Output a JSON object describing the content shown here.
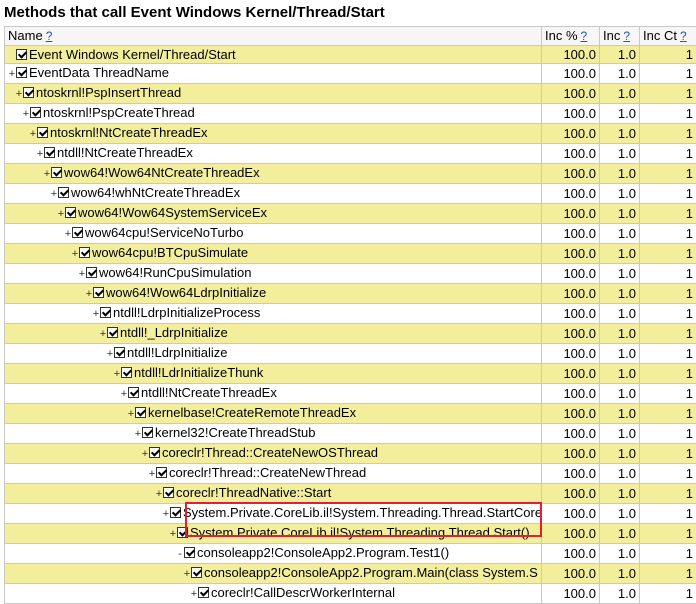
{
  "title": "Methods that call Event Windows Kernel/Thread/Start",
  "help_label": "?",
  "columns": {
    "name": "Name",
    "inc_pct": "Inc %",
    "inc": "Inc",
    "inc_ct": "Inc Ct"
  },
  "rows": [
    {
      "name": "Event Windows Kernel/Thread/Start",
      "indent": 0,
      "expander": "",
      "highlight": true,
      "inc_pct": "100.0",
      "inc": "1.0",
      "inc_ct": "1"
    },
    {
      "name": "EventData ThreadName",
      "indent": 0,
      "expander": "+",
      "highlight": false,
      "inc_pct": "100.0",
      "inc": "1.0",
      "inc_ct": "1"
    },
    {
      "name": "ntoskrnl!PspInsertThread",
      "indent": 1,
      "expander": "+",
      "highlight": true,
      "inc_pct": "100.0",
      "inc": "1.0",
      "inc_ct": "1"
    },
    {
      "name": "ntoskrnl!PspCreateThread",
      "indent": 2,
      "expander": "+",
      "highlight": false,
      "inc_pct": "100.0",
      "inc": "1.0",
      "inc_ct": "1"
    },
    {
      "name": "ntoskrnl!NtCreateThreadEx",
      "indent": 3,
      "expander": "+",
      "highlight": true,
      "inc_pct": "100.0",
      "inc": "1.0",
      "inc_ct": "1"
    },
    {
      "name": "ntdll!NtCreateThreadEx",
      "indent": 4,
      "expander": "+",
      "highlight": false,
      "inc_pct": "100.0",
      "inc": "1.0",
      "inc_ct": "1"
    },
    {
      "name": "wow64!Wow64NtCreateThreadEx",
      "indent": 5,
      "expander": "+",
      "highlight": true,
      "inc_pct": "100.0",
      "inc": "1.0",
      "inc_ct": "1"
    },
    {
      "name": "wow64!whNtCreateThreadEx",
      "indent": 6,
      "expander": "+",
      "highlight": false,
      "inc_pct": "100.0",
      "inc": "1.0",
      "inc_ct": "1"
    },
    {
      "name": "wow64!Wow64SystemServiceEx",
      "indent": 7,
      "expander": "+",
      "highlight": true,
      "inc_pct": "100.0",
      "inc": "1.0",
      "inc_ct": "1"
    },
    {
      "name": "wow64cpu!ServiceNoTurbo",
      "indent": 8,
      "expander": "+",
      "highlight": false,
      "inc_pct": "100.0",
      "inc": "1.0",
      "inc_ct": "1"
    },
    {
      "name": "wow64cpu!BTCpuSimulate",
      "indent": 9,
      "expander": "+",
      "highlight": true,
      "inc_pct": "100.0",
      "inc": "1.0",
      "inc_ct": "1"
    },
    {
      "name": "wow64!RunCpuSimulation",
      "indent": 10,
      "expander": "+",
      "highlight": false,
      "inc_pct": "100.0",
      "inc": "1.0",
      "inc_ct": "1"
    },
    {
      "name": "wow64!Wow64LdrpInitialize",
      "indent": 11,
      "expander": "+",
      "highlight": true,
      "inc_pct": "100.0",
      "inc": "1.0",
      "inc_ct": "1"
    },
    {
      "name": "ntdll!LdrpInitializeProcess",
      "indent": 12,
      "expander": "+",
      "highlight": false,
      "inc_pct": "100.0",
      "inc": "1.0",
      "inc_ct": "1"
    },
    {
      "name": "ntdll!_LdrpInitialize",
      "indent": 13,
      "expander": "+",
      "highlight": true,
      "inc_pct": "100.0",
      "inc": "1.0",
      "inc_ct": "1"
    },
    {
      "name": "ntdll!LdrpInitialize",
      "indent": 14,
      "expander": "+",
      "highlight": false,
      "inc_pct": "100.0",
      "inc": "1.0",
      "inc_ct": "1"
    },
    {
      "name": "ntdll!LdrInitializeThunk",
      "indent": 15,
      "expander": "+",
      "highlight": true,
      "inc_pct": "100.0",
      "inc": "1.0",
      "inc_ct": "1"
    },
    {
      "name": "ntdll!NtCreateThreadEx",
      "indent": 16,
      "expander": "+",
      "highlight": false,
      "inc_pct": "100.0",
      "inc": "1.0",
      "inc_ct": "1"
    },
    {
      "name": "kernelbase!CreateRemoteThreadEx",
      "indent": 17,
      "expander": "+",
      "highlight": true,
      "inc_pct": "100.0",
      "inc": "1.0",
      "inc_ct": "1"
    },
    {
      "name": "kernel32!CreateThreadStub",
      "indent": 18,
      "expander": "+",
      "highlight": false,
      "inc_pct": "100.0",
      "inc": "1.0",
      "inc_ct": "1"
    },
    {
      "name": "coreclr!Thread::CreateNewOSThread",
      "indent": 19,
      "expander": "+",
      "highlight": true,
      "inc_pct": "100.0",
      "inc": "1.0",
      "inc_ct": "1"
    },
    {
      "name": "coreclr!Thread::CreateNewThread",
      "indent": 20,
      "expander": "+",
      "highlight": false,
      "inc_pct": "100.0",
      "inc": "1.0",
      "inc_ct": "1"
    },
    {
      "name": "coreclr!ThreadNative::Start",
      "indent": 21,
      "expander": "+",
      "highlight": true,
      "inc_pct": "100.0",
      "inc": "1.0",
      "inc_ct": "1"
    },
    {
      "name": "System.Private.CoreLib.il!System.Threading.Thread.StartCore",
      "indent": 22,
      "expander": "+",
      "highlight": false,
      "inc_pct": "100.0",
      "inc": "1.0",
      "inc_ct": "1"
    },
    {
      "name": "System.Private.CoreLib.il!System.Threading.Thread.Start()",
      "indent": 23,
      "expander": "+",
      "highlight": true,
      "inc_pct": "100.0",
      "inc": "1.0",
      "inc_ct": "1"
    },
    {
      "name": "consoleapp2!ConsoleApp2.Program.Test1()",
      "indent": 24,
      "expander": "-",
      "highlight": false,
      "inc_pct": "100.0",
      "inc": "1.0",
      "inc_ct": "1"
    },
    {
      "name": "consoleapp2!ConsoleApp2.Program.Main(class System.S",
      "indent": 25,
      "expander": "+",
      "highlight": true,
      "inc_pct": "100.0",
      "inc": "1.0",
      "inc_ct": "1"
    },
    {
      "name": "coreclr!CallDescrWorkerInternal",
      "indent": 26,
      "expander": "+",
      "highlight": false,
      "inc_pct": "100.0",
      "inc": "1.0",
      "inc_ct": "1"
    }
  ]
}
